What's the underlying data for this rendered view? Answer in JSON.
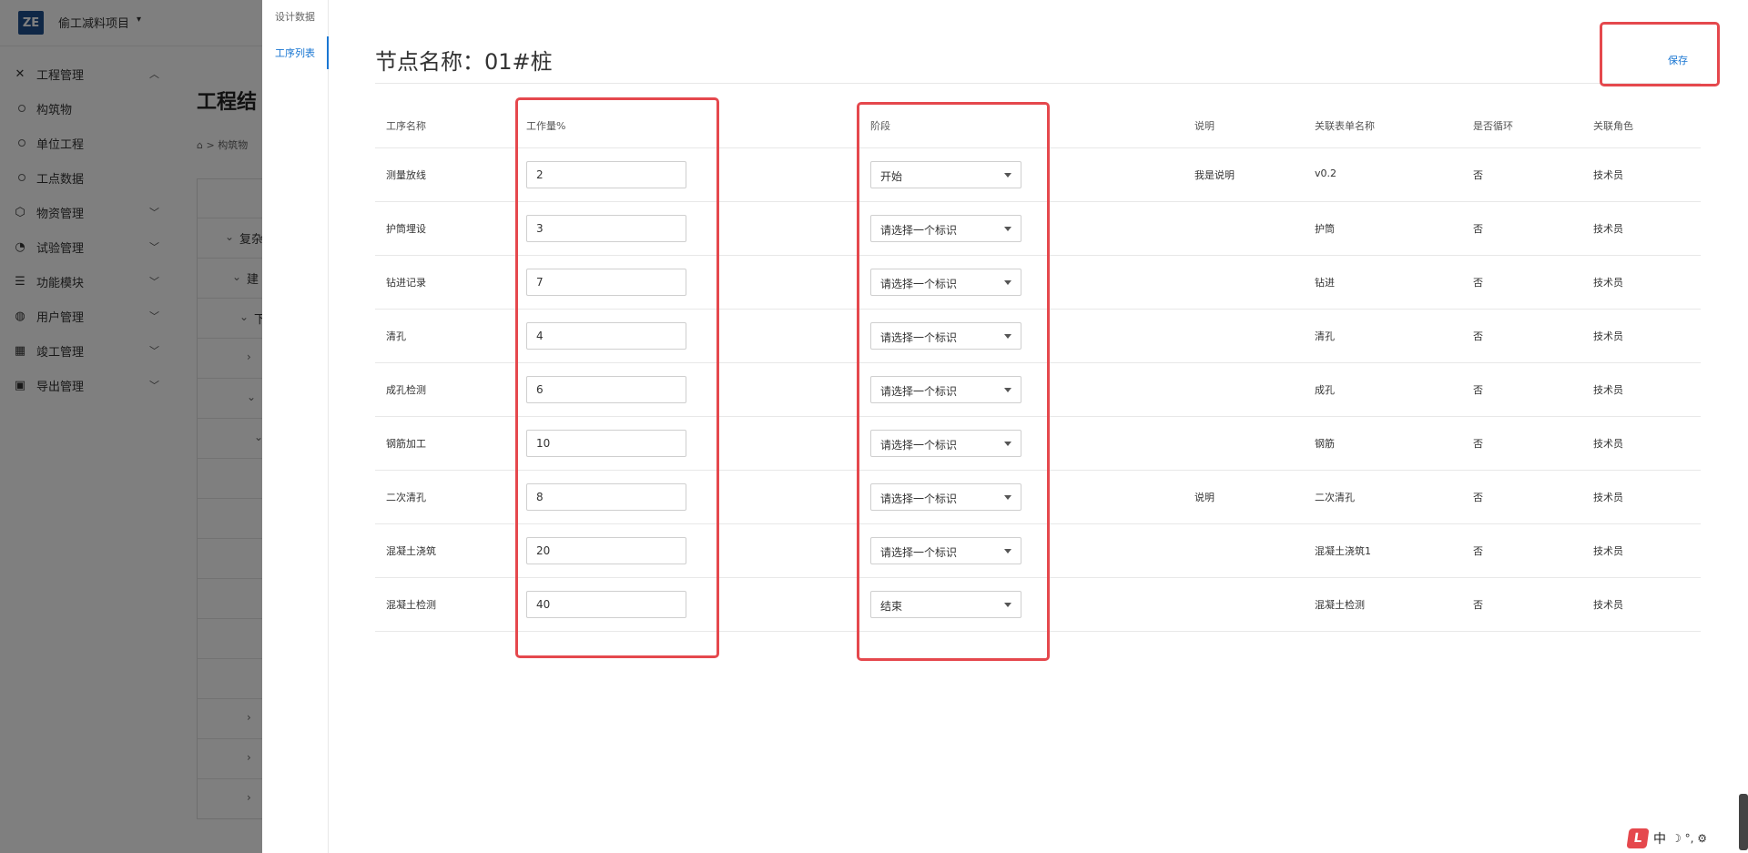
{
  "app": {
    "logo_text": "ZE",
    "project_name": "偷工减料项目",
    "menu": [
      {
        "icon": "tools-icon",
        "label": "工程管理",
        "expanded": true,
        "children": [
          "构筑物",
          "单位工程",
          "工点数据"
        ]
      },
      {
        "icon": "box-icon",
        "label": "物资管理"
      },
      {
        "icon": "gauge-icon",
        "label": "试验管理"
      },
      {
        "icon": "sliders-icon",
        "label": "功能模块"
      },
      {
        "icon": "palette-icon",
        "label": "用户管理"
      },
      {
        "icon": "calendar-icon",
        "label": "竣工管理"
      },
      {
        "icon": "export-icon",
        "label": "导出管理"
      }
    ],
    "page_title": "工程结",
    "breadcrumb": "构筑物",
    "tree_rows": [
      "复杂",
      "建",
      "下"
    ]
  },
  "drawer": {
    "tabs": [
      {
        "label": "设计数据",
        "active": false
      },
      {
        "label": "工序列表",
        "active": true
      }
    ],
    "node_title": "节点名称：01#桩",
    "save_label": "保存",
    "columns": {
      "process_name": "工序名称",
      "workload": "工作量%",
      "stage": "阶段",
      "note": "说明",
      "form_name": "关联表单名称",
      "loop": "是否循环",
      "role": "关联角色"
    },
    "rows": [
      {
        "name": "测量放线",
        "workload": "2",
        "stage": "开始",
        "note": "我是说明",
        "form": "v0.2",
        "loop": "否",
        "role": "技术员"
      },
      {
        "name": "护筒埋设",
        "workload": "3",
        "stage": "请选择一个标识",
        "note": "",
        "form": "护筒",
        "loop": "否",
        "role": "技术员"
      },
      {
        "name": "钻进记录",
        "workload": "7",
        "stage": "请选择一个标识",
        "note": "",
        "form": "钻进",
        "loop": "否",
        "role": "技术员"
      },
      {
        "name": "清孔",
        "workload": "4",
        "stage": "请选择一个标识",
        "note": "",
        "form": "清孔",
        "loop": "否",
        "role": "技术员"
      },
      {
        "name": "成孔检测",
        "workload": "6",
        "stage": "请选择一个标识",
        "note": "",
        "form": "成孔",
        "loop": "否",
        "role": "技术员"
      },
      {
        "name": "钢筋加工",
        "workload": "10",
        "stage": "请选择一个标识",
        "note": "",
        "form": "钢筋",
        "loop": "否",
        "role": "技术员"
      },
      {
        "name": "二次清孔",
        "workload": "8",
        "stage": "请选择一个标识",
        "note": "说明",
        "form": "二次清孔",
        "loop": "否",
        "role": "技术员"
      },
      {
        "name": "混凝土浇筑",
        "workload": "20",
        "stage": "请选择一个标识",
        "note": "",
        "form": "混凝土浇筑1",
        "loop": "否",
        "role": "技术员"
      },
      {
        "name": "混凝土检测",
        "workload": "40",
        "stage": "结束",
        "note": "",
        "form": "混凝土检测",
        "loop": "否",
        "role": "技术员"
      }
    ]
  },
  "ime": {
    "badge": "L",
    "mode": "中",
    "symbols": "☽ °, ⚙"
  },
  "colors": {
    "accent": "#1976d2",
    "annotation_red": "#e5484d",
    "overlay": "rgba(0,0,0,0.5)"
  }
}
